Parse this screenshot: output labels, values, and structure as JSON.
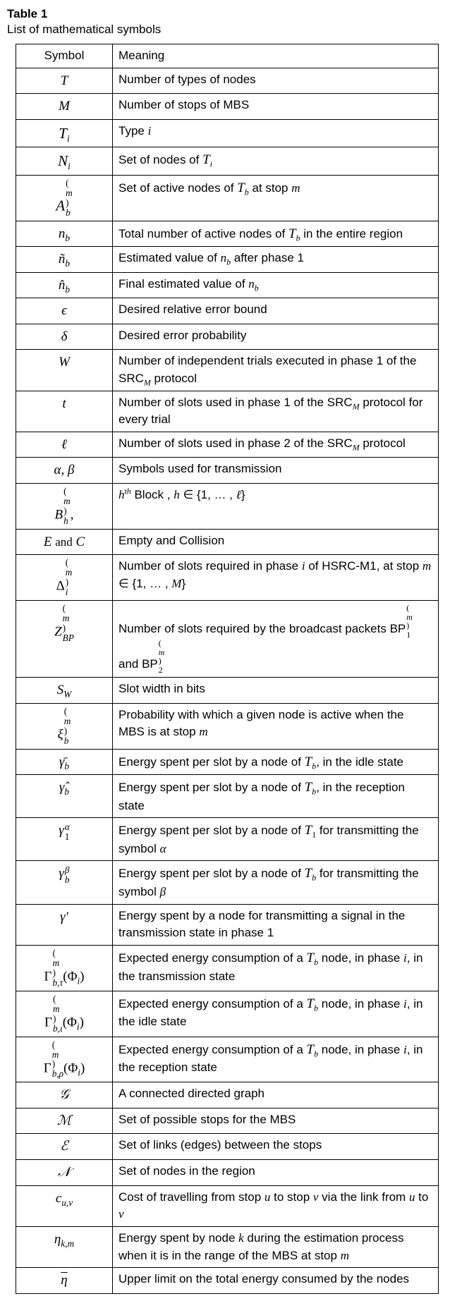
{
  "table_label": "Table 1",
  "table_caption": "List of mathematical symbols",
  "header": {
    "symbol": "Symbol",
    "meaning": "Meaning"
  },
  "rows": [
    {
      "s": "T",
      "m": "Number of types of nodes"
    },
    {
      "s": "M",
      "m": "Number of stops of MBS"
    },
    {
      "s": "Ti_scr",
      "m": "Type i"
    },
    {
      "s": "Ni_scr",
      "m": "Set of nodes of Ti"
    },
    {
      "s": "Ab_m_scr",
      "m": "Set of active nodes of Tb at stop m"
    },
    {
      "s": "nb",
      "m": "Total number of active nodes of Tb in the entire region"
    },
    {
      "s": "n_tilde_b",
      "m": "Estimated value of nb after phase 1"
    },
    {
      "s": "n_hat_b",
      "m": "Final estimated value of nb"
    },
    {
      "s": "epsilon",
      "m": "Desired relative error bound"
    },
    {
      "s": "delta",
      "m": "Desired error probability"
    },
    {
      "s": "W",
      "m": "Number of independent trials executed in phase 1 of the SRCM protocol"
    },
    {
      "s": "t_it",
      "m": "Number of slots used in phase 1 of the SRCM protocol for every trial"
    },
    {
      "s": "ell",
      "m": "Number of slots used in phase 2 of the SRCM protocol"
    },
    {
      "s": "alpha_beta",
      "m": "Symbols used for transmission"
    },
    {
      "s": "Bh_m",
      "m": "h-th Block , h in {1,...,l}"
    },
    {
      "s": "E_and_C",
      "m": "Empty and Collision"
    },
    {
      "s": "Delta_i_m",
      "m": "Number of slots required in phase i of HSRC-M1, at stop m in {1,...,M}"
    },
    {
      "s": "ZBP_m",
      "m": "Number of slots required by the broadcast packets BP1(m) and BP2(m)"
    },
    {
      "s": "SW",
      "m": "Slot width in bits"
    },
    {
      "s": "xi_b_m",
      "m": "Probability with which a given node is active when the MBS is at stop m"
    },
    {
      "s": "gamma_bar_b",
      "m": "Energy spent per slot by a node of Tb, in the idle state"
    },
    {
      "s": "gamma_hat_b",
      "m": "Energy spent per slot by a node of Tb, in the reception state"
    },
    {
      "s": "gamma_1_alpha",
      "m": "Energy spent per slot by a node of T1 for transmitting the symbol alpha"
    },
    {
      "s": "gamma_b_beta",
      "m": "Energy spent per slot by a node of Tb for transmitting the symbol beta"
    },
    {
      "s": "gamma_prime",
      "m": "Energy spent by a node for transmitting a signal in the transmission state in phase 1"
    },
    {
      "s": "Gamma_btau_m_Phi_i",
      "m": "Expected energy consumption of a Tb node, in phase i, in the transmission state"
    },
    {
      "s": "Gamma_biota_m_Phi_i",
      "m": "Expected energy consumption of a Tb node, in phase i, in the idle state"
    },
    {
      "s": "Gamma_brho_m_Phi_i",
      "m": "Expected energy consumption of a Tb node, in phase i, in the reception state"
    },
    {
      "s": "calG",
      "m": "A connected directed graph"
    },
    {
      "s": "calM",
      "m": "Set of possible stops for the MBS"
    },
    {
      "s": "calE",
      "m": "Set of links (edges) between the stops"
    },
    {
      "s": "calN",
      "m": "Set of nodes in the region"
    },
    {
      "s": "c_uv",
      "m": "Cost of travelling from stop u to stop v via the link from u to v"
    },
    {
      "s": "eta_km",
      "m": "Energy spent by node k during the estimation process when it is in the range of the MBS at stop m"
    },
    {
      "s": "eta_bar",
      "m": "Upper limit on the total energy consumed by the nodes"
    }
  ]
}
